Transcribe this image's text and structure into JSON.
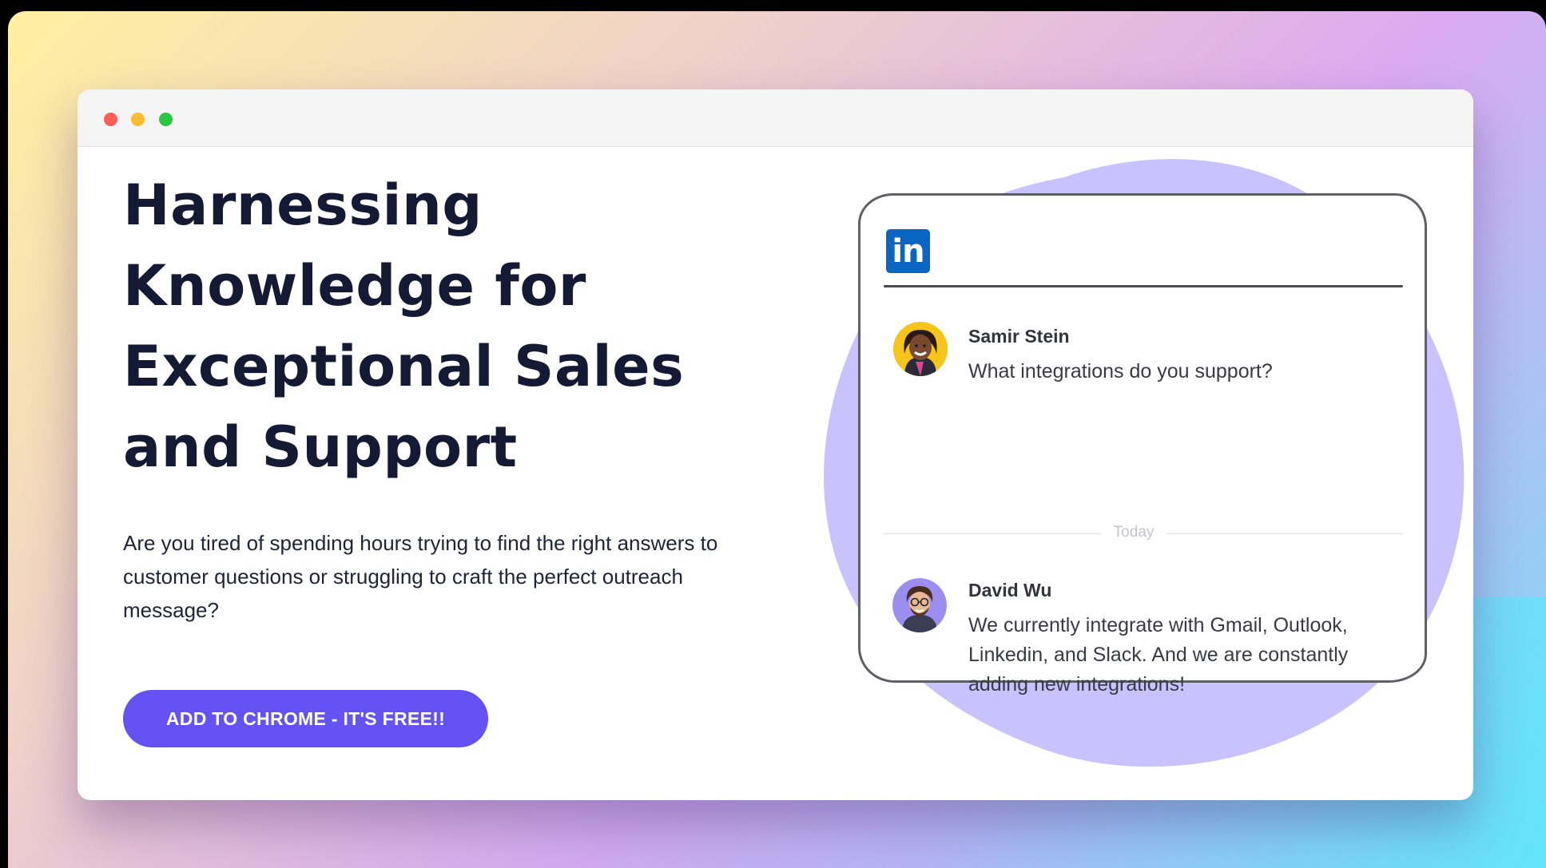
{
  "window": {
    "controls": [
      "close",
      "minimize",
      "maximize"
    ]
  },
  "hero": {
    "headline_lines": [
      "Harnessing",
      "Knowledge for",
      "Exceptional Sales",
      "and Support"
    ],
    "subtext": "Are you tired of spending hours trying to find the right answers to customer questions or struggling to craft the perfect outreach message?",
    "cta_label": "ADD TO CHROME - IT'S FREE!!"
  },
  "chat_card": {
    "platform_logo": "in",
    "divider_label": "Today",
    "messages": [
      {
        "sender": "Samir Stein",
        "text": "What integrations do you support?"
      },
      {
        "sender": "David Wu",
        "text": "We currently integrate with Gmail, Outlook, Linkedin, and Slack. And we are constantly adding new integrations!"
      }
    ]
  },
  "colors": {
    "accent": "#6452f5",
    "headline": "#141a33",
    "blob": "#c9c2ff",
    "linkedin": "#0a66c2"
  },
  "icons": {
    "logo": "linkedin-icon",
    "avatars": [
      "samir-stein-avatar",
      "david-wu-avatar"
    ]
  }
}
